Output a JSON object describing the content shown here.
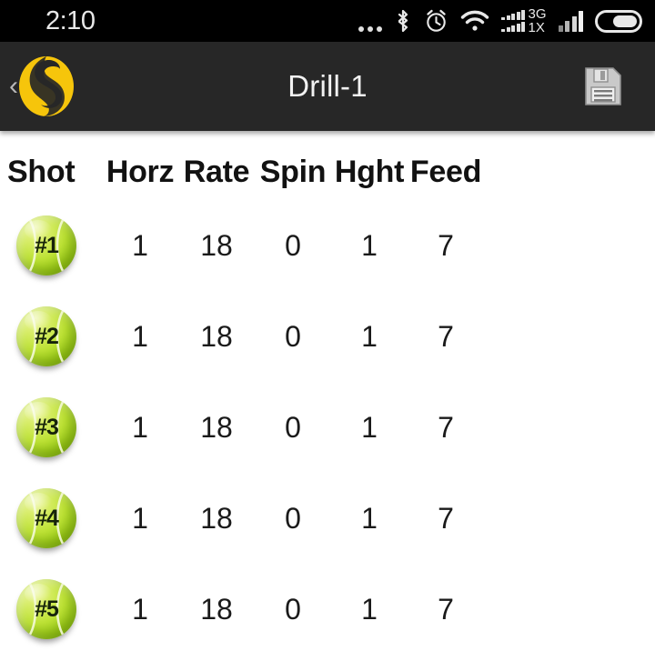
{
  "status_bar": {
    "time": "2:10",
    "icons": [
      "more-dots-icon",
      "bluetooth-icon",
      "alarm-clock-icon",
      "wifi-icon",
      "cellular-3g-1x-icon",
      "cellular-signal-icon",
      "battery-icon"
    ],
    "network_primary": "3G",
    "network_secondary": "1X",
    "background": "#000000"
  },
  "app_bar": {
    "back_label": "‹",
    "logo_name": "spinfire-s-logo",
    "title": "Drill-1",
    "save_icon": "save-floppy-icon",
    "background": "#272727",
    "logo_color": "#F6C50B"
  },
  "table": {
    "columns": [
      "Shot",
      "Horz",
      "Rate",
      "Spin",
      "Hght",
      "Feed"
    ],
    "rows": [
      {
        "shot": "#1",
        "horz": "1",
        "rate": "18",
        "spin": "0",
        "hght": "1",
        "feed": "7"
      },
      {
        "shot": "#2",
        "horz": "1",
        "rate": "18",
        "spin": "0",
        "hght": "1",
        "feed": "7"
      },
      {
        "shot": "#3",
        "horz": "1",
        "rate": "18",
        "spin": "0",
        "hght": "1",
        "feed": "7"
      },
      {
        "shot": "#4",
        "horz": "1",
        "rate": "18",
        "spin": "0",
        "hght": "1",
        "feed": "7"
      },
      {
        "shot": "#5",
        "horz": "1",
        "rate": "18",
        "spin": "0",
        "hght": "1",
        "feed": "7"
      }
    ],
    "ball_color": "#BDE235",
    "background": "#FFFFFF"
  }
}
